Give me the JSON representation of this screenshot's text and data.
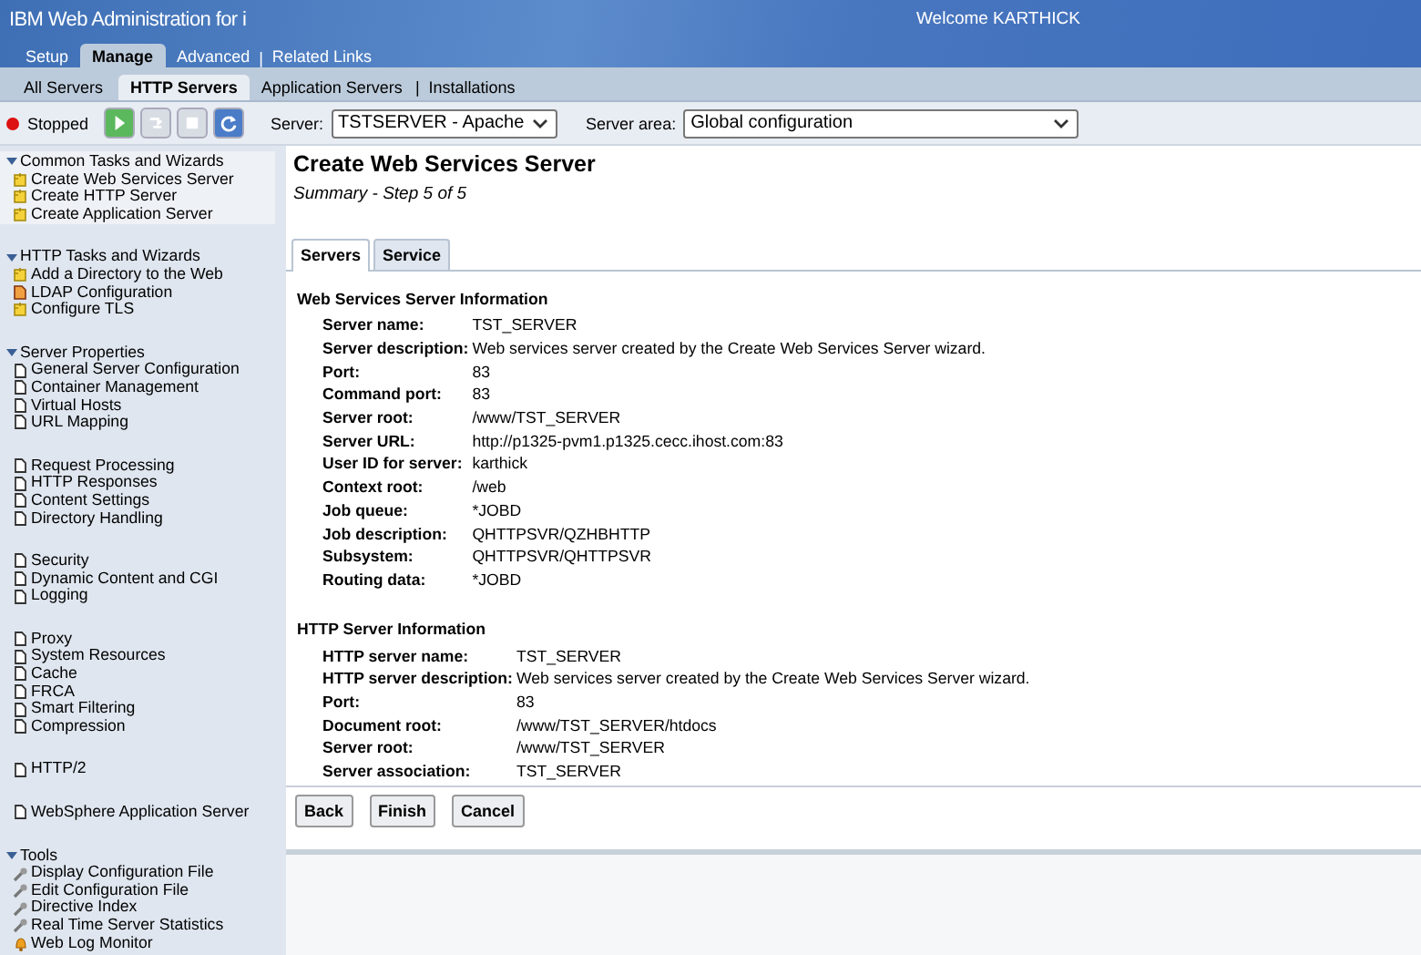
{
  "header": {
    "title": "IBM Web Administration for i",
    "welcome": "Welcome  KARTHICK"
  },
  "main_tabs": [
    {
      "label": "Setup",
      "selected": false
    },
    {
      "label": "Manage",
      "selected": true
    },
    {
      "label": "Advanced",
      "selected": false
    },
    {
      "label": "Related Links",
      "selected": false,
      "separator_before": "|"
    }
  ],
  "sub_tabs": [
    {
      "label": "All Servers",
      "selected": false
    },
    {
      "label": "HTTP Servers",
      "selected": true
    },
    {
      "label": "Application Servers",
      "selected": false
    },
    {
      "label": "Installations",
      "selected": false,
      "separator_before": "|"
    }
  ],
  "toolbar": {
    "status": {
      "label": "Stopped",
      "running": false
    },
    "buttons": [
      {
        "kind": "start",
        "disabled": false
      },
      {
        "kind": "restart",
        "disabled": true
      },
      {
        "kind": "stop",
        "disabled": true
      },
      {
        "kind": "refresh",
        "disabled": false
      }
    ],
    "server_label": "Server:",
    "server_value": "TSTSERVER - Apache",
    "area_label": "Server area:",
    "area_value": "Global configuration"
  },
  "sidebar": {
    "sections": [
      {
        "heading": "Common Tasks and Wizards",
        "expanded": true,
        "selected": true,
        "items": [
          {
            "label": "Create Web Services Server",
            "kind": "wizard"
          },
          {
            "label": "Create HTTP Server",
            "kind": "wizard"
          },
          {
            "label": "Create Application Server",
            "kind": "wizard"
          }
        ]
      },
      {
        "heading": "HTTP Tasks and Wizards",
        "expanded": true,
        "selected": false,
        "items": [
          {
            "label": "Add a Directory to the Web",
            "kind": "wizard"
          },
          {
            "label": "LDAP Configuration",
            "kind": "ldap"
          },
          {
            "label": "Configure TLS",
            "kind": "wizard"
          }
        ]
      },
      {
        "heading": "Server Properties",
        "expanded": true,
        "selected": false,
        "items": [
          {
            "label": "General Server Configuration",
            "kind": "page"
          },
          {
            "label": "Container Management",
            "kind": "page"
          },
          {
            "label": "Virtual Hosts",
            "kind": "page"
          },
          {
            "label": "URL Mapping",
            "kind": "page"
          }
        ]
      },
      {
        "selected": false,
        "items": [
          {
            "label": "Request Processing",
            "kind": "page"
          },
          {
            "label": "HTTP Responses",
            "kind": "page"
          },
          {
            "label": "Content Settings",
            "kind": "page"
          },
          {
            "label": "Directory Handling",
            "kind": "page"
          }
        ]
      },
      {
        "selected": false,
        "items": [
          {
            "label": "Security",
            "kind": "page"
          },
          {
            "label": "Dynamic Content and CGI",
            "kind": "page"
          },
          {
            "label": "Logging",
            "kind": "page"
          }
        ]
      },
      {
        "selected": false,
        "items": [
          {
            "label": "Proxy",
            "kind": "page"
          },
          {
            "label": "System Resources",
            "kind": "page"
          },
          {
            "label": "Cache",
            "kind": "page"
          },
          {
            "label": "FRCA",
            "kind": "page"
          },
          {
            "label": "Smart Filtering",
            "kind": "page"
          },
          {
            "label": "Compression",
            "kind": "page"
          }
        ]
      },
      {
        "selected": false,
        "items": [
          {
            "label": "HTTP/2",
            "kind": "page"
          }
        ]
      },
      {
        "selected": false,
        "items": [
          {
            "label": "WebSphere Application Server",
            "kind": "page"
          }
        ]
      },
      {
        "heading": "Tools",
        "expanded": true,
        "selected": false,
        "items": [
          {
            "label": "Display Configuration File",
            "kind": "tool"
          },
          {
            "label": "Edit Configuration File",
            "kind": "tool"
          },
          {
            "label": "Directive Index",
            "kind": "tool"
          },
          {
            "label": "Real Time Server Statistics",
            "kind": "tool"
          },
          {
            "label": "Web Log Monitor",
            "kind": "monitor"
          }
        ]
      }
    ]
  },
  "content": {
    "title": "Create Web Services Server",
    "subtitle": "Summary - Step 5 of 5",
    "tabs": [
      {
        "label": "Servers",
        "selected": true
      },
      {
        "label": "Service",
        "selected": false
      }
    ],
    "sections": [
      {
        "heading": "Web Services Server Information",
        "rows": [
          {
            "label": "Server name:",
            "value": "TST_SERVER"
          },
          {
            "label": "Server description:",
            "value": "Web services server created by the Create Web Services Server wizard."
          },
          {
            "label": "Port:",
            "value": "83"
          },
          {
            "label": "Command port:",
            "value": "83"
          },
          {
            "label": "Server root:",
            "value": "/www/TST_SERVER"
          },
          {
            "label": "Server URL:",
            "value": "http://p1325-pvm1.p1325.cecc.ihost.com:83"
          },
          {
            "label": "User ID for server:",
            "value": "karthick"
          },
          {
            "label": "Context root:",
            "value": "/web"
          },
          {
            "label": "Job queue:",
            "value": "*JOBD"
          },
          {
            "label": "Job description:",
            "value": "QHTTPSVR/QZHBHTTP"
          },
          {
            "label": "Subsystem:",
            "value": "QHTTPSVR/QHTTPSVR"
          },
          {
            "label": "Routing data:",
            "value": "*JOBD"
          }
        ]
      },
      {
        "heading": "HTTP Server Information",
        "rows": [
          {
            "label": "HTTP server name:",
            "value": "TST_SERVER"
          },
          {
            "label": "HTTP server description:",
            "value": "Web services server created by the Create Web Services Server wizard."
          },
          {
            "label": "Port:",
            "value": "83"
          },
          {
            "label": "Document root:",
            "value": "/www/TST_SERVER/htdocs"
          },
          {
            "label": "Server root:",
            "value": "/www/TST_SERVER"
          },
          {
            "label": "Server association:",
            "value": "TST_SERVER"
          }
        ]
      }
    ],
    "buttons": [
      "Back",
      "Finish",
      "Cancel"
    ]
  }
}
